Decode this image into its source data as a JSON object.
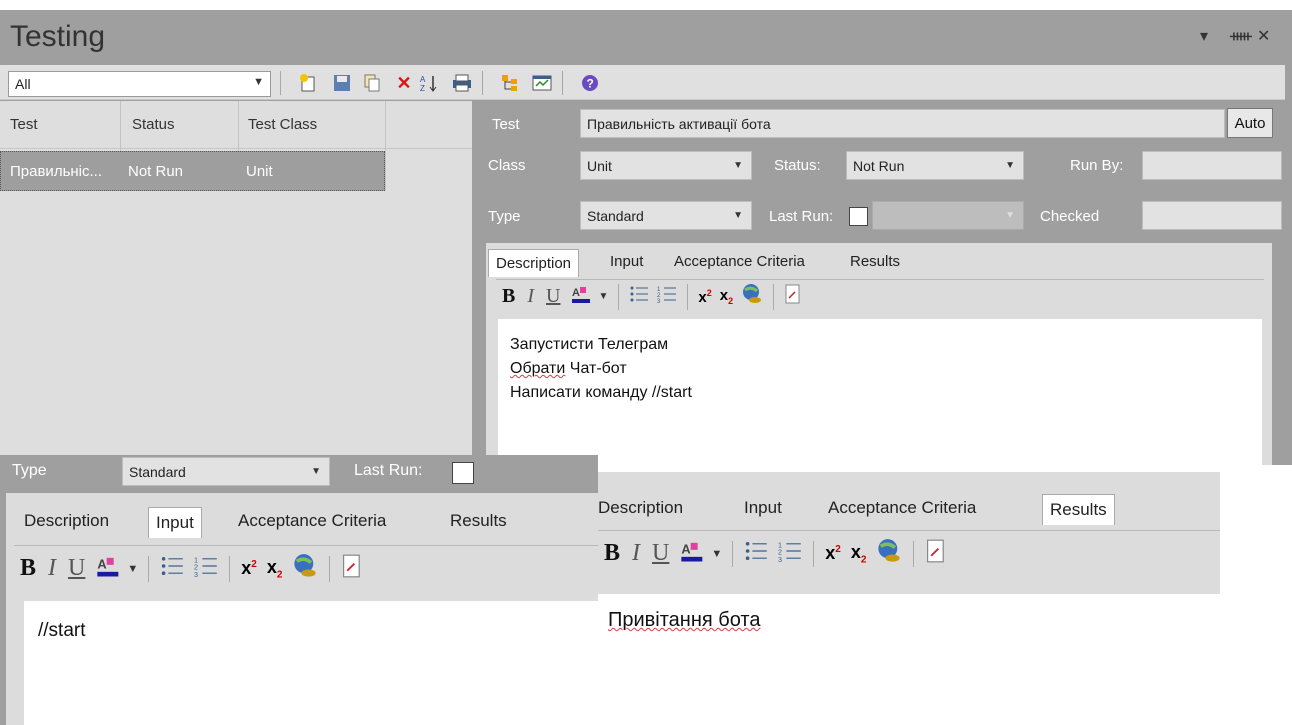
{
  "window": {
    "title": "Testing",
    "controls": [
      "▾",
      "ᚔ",
      "✕"
    ]
  },
  "toolbar": {
    "filter_value": "All"
  },
  "list": {
    "headers": [
      "Test",
      "Status",
      "Test Class"
    ],
    "rows": [
      {
        "test": "Правильніс...",
        "status": "Not Run",
        "class": "Unit"
      }
    ]
  },
  "details": {
    "test_label": "Test",
    "test_value": "Правильність активації бота",
    "auto_label": "Auto",
    "class_label": "Class",
    "class_value": "Unit",
    "status_label": "Status:",
    "status_value": "Not Run",
    "runby_label": "Run By:",
    "type_label": "Type",
    "type_value": "Standard",
    "lastrun_label": "Last Run:",
    "checked_label": "Checked"
  },
  "tabs": [
    "Description",
    "Input",
    "Acceptance Criteria",
    "Results"
  ],
  "description_lines": [
    "Запустисти Телеграм",
    "Обрати",
    " Чат-бот",
    "Написати команду //start"
  ],
  "overlay1": {
    "type_label": "Type",
    "type_value": "Standard",
    "lastrun_label": "Last Run:",
    "input_text": "//start"
  },
  "overlay2": {
    "results_text": "Привітання бота"
  }
}
